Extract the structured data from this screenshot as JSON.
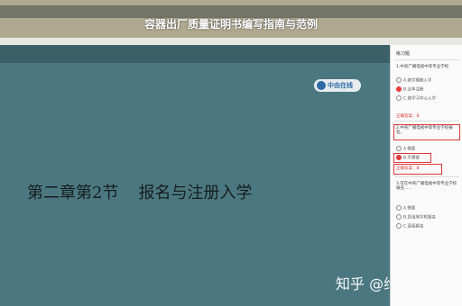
{
  "banner": {
    "blurred_text": "",
    "headline": "容器出厂质量证明书编写指南与范例"
  },
  "slide": {
    "header_text": "",
    "logo_text": "中由在线",
    "chapter": "第二章第2节",
    "section": "报名与注册入学"
  },
  "watermark": "知乎 @维莉Kath",
  "panel": {
    "title": "练习题",
    "q1": "1.中央广播电视中等专业学校",
    "q1_options": [
      "A.按学期随入学",
      "B.全年注册",
      "C.按学习中心入学"
    ],
    "q1_answer": "正确答案：B",
    "q2": "2.中央广播电视中等专业学校报名。",
    "q2_options": [
      "A.需要",
      "B.不需要"
    ],
    "q2_answer": "正确答案：B",
    "q3": "3.可在中央广播电视中等专业学校报名……",
    "q3_options": [
      "A.需要",
      "B.到当地学校报名",
      "C.直接报名"
    ],
    "colors": {
      "accent": "#e23a3a",
      "slide_bg": "#4b7880"
    }
  }
}
